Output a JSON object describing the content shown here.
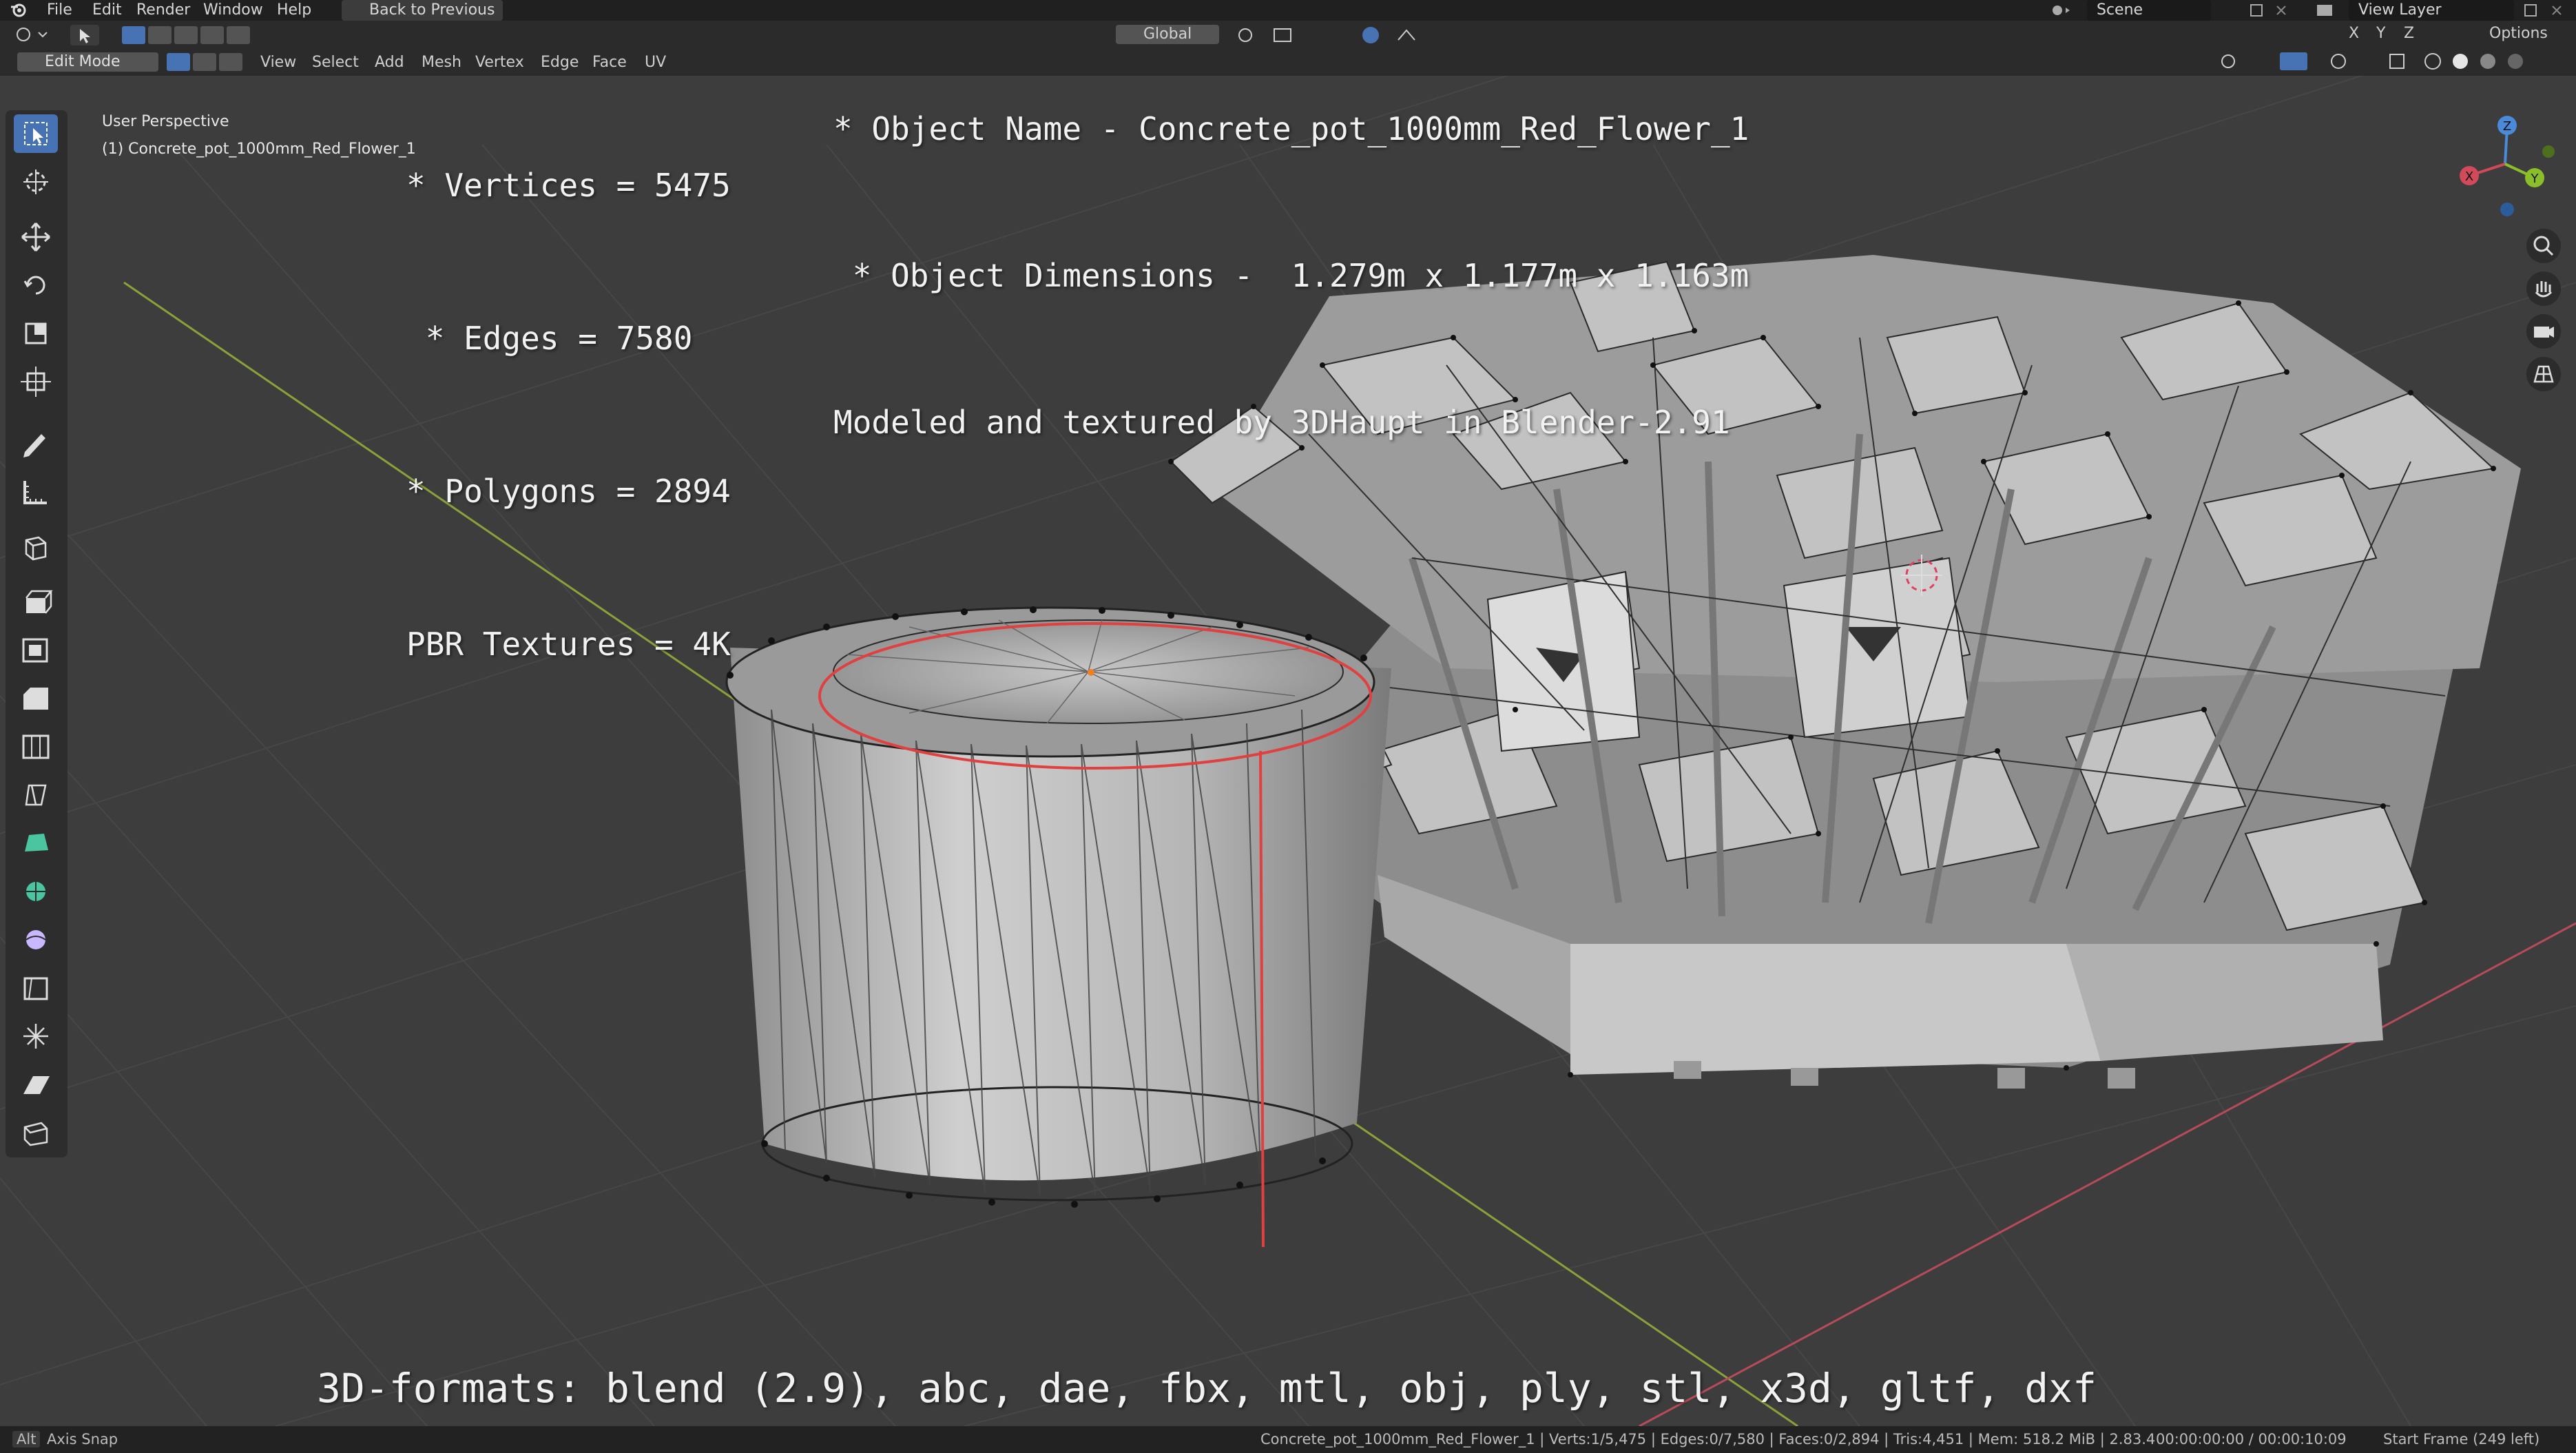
{
  "topbar": {
    "menus": [
      "File",
      "Edit",
      "Render",
      "Window",
      "Help"
    ],
    "back_label": "Back to Previous",
    "scene_label": "Scene",
    "view_layer_label": "View Layer"
  },
  "header": {
    "mode": "Edit Mode",
    "menus": [
      "View",
      "Select",
      "Add",
      "Mesh",
      "Vertex",
      "Edge",
      "Face",
      "UV"
    ],
    "orientation": "Global",
    "axes": [
      "X",
      "Y",
      "Z"
    ],
    "options_label": "Options"
  },
  "viewport": {
    "perspective": "User Perspective",
    "object_label": "(1) Concrete_pot_1000mm_Red_Flower_1"
  },
  "overlay": {
    "stats": [
      "* Vertices = 5475",
      " * Edges = 7580",
      "* Polygons = 2894",
      "PBR Textures = 4K"
    ],
    "info": [
      "* Object Name - Concrete_pot_1000mm_Red_Flower_1",
      " * Object Dimensions -  1.279m x 1.177m x 1.163m",
      "Modeled and textured by 3DHaupt in Blender-2.91"
    ],
    "formats": "3D-formats: blend (2.9), abc, dae, fbx, mtl, obj, ply, stl, x3d, gltf, dxf"
  },
  "gizmo": {
    "x": "X",
    "y": "Y",
    "z": "Z"
  },
  "statusbar": {
    "left_key": "Alt",
    "left": "Axis Snap",
    "center": "Concrete_pot_1000mm_Red_Flower_1 | Verts:1/5,475 | Edges:0/7,580 | Faces:0/2,894 | Tris:4,451 | Mem: 518.2 MiB | 2.83.4",
    "time": "00:00:00:00 / 00:00:10:09",
    "frame": "Start Frame (249 left)"
  },
  "colors": {
    "grid": "#474747",
    "axis_x": "#b84b5a",
    "axis_y": "#8aa23a",
    "selected_edge": "#e04040",
    "active_tool": "#4772b3"
  }
}
